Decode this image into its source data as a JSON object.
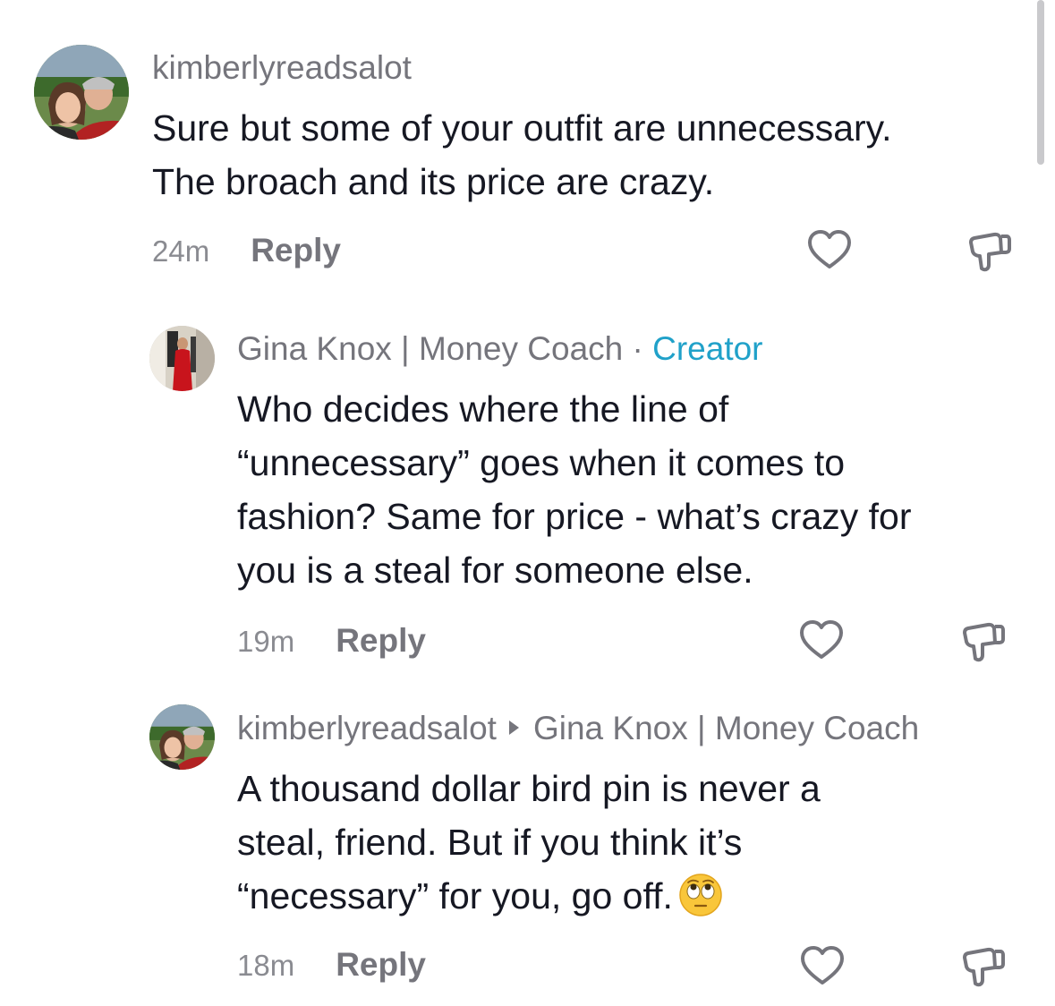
{
  "comments": [
    {
      "username": "kimberlyreadsalot",
      "lines": [
        "Sure but some of your outfit are unnecessary.",
        "The broach and its price are crazy."
      ],
      "time": "24m",
      "reply_label": "Reply",
      "avatar_icon": "couple-photo-avatar"
    },
    {
      "username": "Gina Knox | Money Coach",
      "separator": "·",
      "badge": "Creator",
      "lines": [
        "Who decides where the line of",
        "“unnecessary” goes when it comes to",
        "fashion? Same for price - what’s crazy for",
        "you is a steal for someone else."
      ],
      "time": "19m",
      "reply_label": "Reply",
      "avatar_icon": "woman-red-dress-avatar"
    },
    {
      "username": "kimberlyreadsalot",
      "reply_to": "Gina Knox | Money Coach",
      "lines": [
        "A thousand dollar bird pin is never a",
        "steal, friend. But if you think it’s",
        "“necessary” for you, go off."
      ],
      "emoji": "eye-roll-emoji",
      "time": "18m",
      "reply_label": "Reply",
      "avatar_icon": "couple-photo-avatar"
    }
  ],
  "icons": {
    "like": "heart-outline-icon",
    "dislike": "thumbs-down-outline-icon"
  },
  "colors": {
    "text": "#161823",
    "secondary": "#75757c",
    "creator": "#20a1c9"
  }
}
